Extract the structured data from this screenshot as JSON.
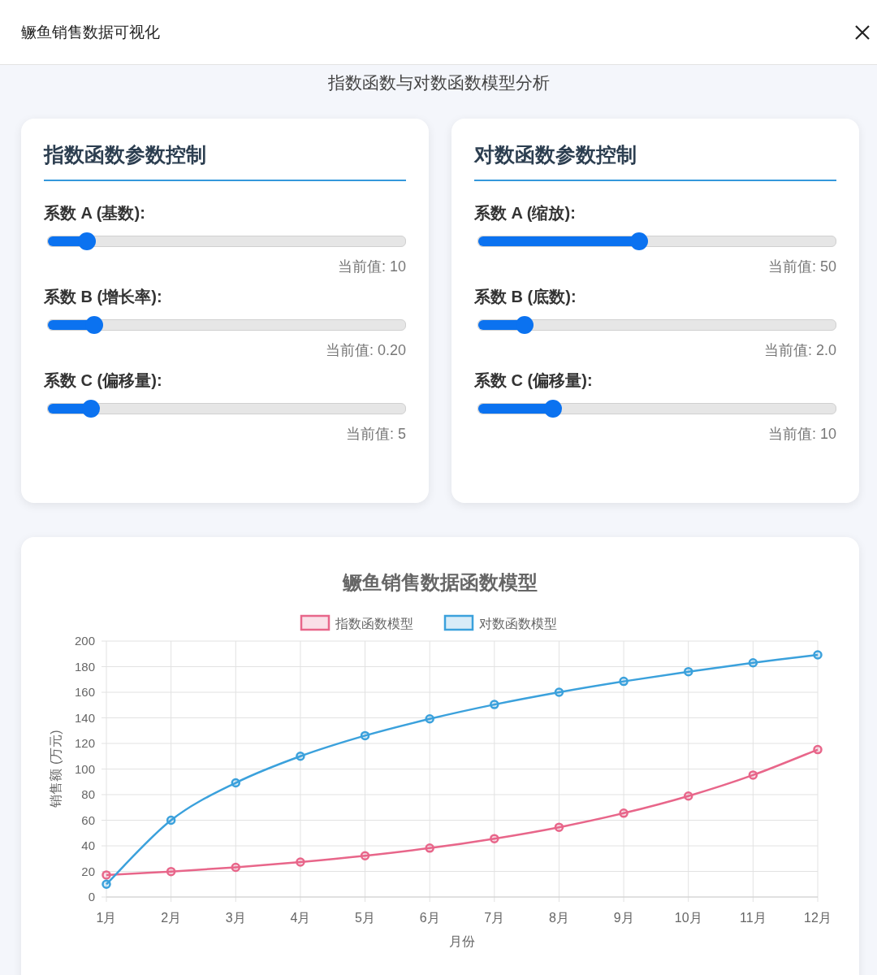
{
  "window": {
    "title": "鳜鱼销售数据可视化"
  },
  "subtitle": "指数函数与对数函数模型分析",
  "panels": [
    {
      "title": "指数函数参数控制",
      "params": [
        {
          "label": "系数 A (基数):",
          "level": 0.11,
          "reading": "当前值: 10"
        },
        {
          "label": "系数 B (增长率):",
          "level": 0.13,
          "reading": "当前值: 0.20"
        },
        {
          "label": "系数 C (偏移量):",
          "level": 0.12,
          "reading": "当前值: 5"
        }
      ]
    },
    {
      "title": "对数函数参数控制",
      "params": [
        {
          "label": "系数 A (缩放):",
          "level": 0.45,
          "reading": "当前值: 50"
        },
        {
          "label": "系数 B (底数):",
          "level": 0.13,
          "reading": "当前值: 2.0"
        },
        {
          "label": "系数 C (偏移量):",
          "level": 0.21,
          "reading": "当前值: 10"
        }
      ]
    }
  ],
  "chart": {
    "chart_data": {
      "type": "line",
      "title": "鳜鱼销售数据函数模型",
      "xlabel": "月份",
      "ylabel": "销售额 (万元)",
      "categories": [
        "1月",
        "2月",
        "3月",
        "4月",
        "5月",
        "6月",
        "7月",
        "8月",
        "9月",
        "10月",
        "11月",
        "12月"
      ],
      "series": [
        {
          "name": "指数函数模型",
          "color": "#e8668a",
          "marker": "circle",
          "values": [
            17.2,
            19.9,
            23.2,
            27.3,
            32.2,
            38.2,
            45.6,
            54.5,
            65.5,
            78.9,
            95.3,
            115.2
          ]
        },
        {
          "name": "对数函数模型",
          "color": "#3ba1dc",
          "marker": "circle",
          "values": [
            10,
            60,
            89.2,
            110,
            126.1,
            139.2,
            150.4,
            160,
            168.5,
            176.1,
            183,
            189.2
          ]
        }
      ],
      "ylim": [
        0,
        200
      ],
      "grid": true,
      "legend": true,
      "yticks": [
        0,
        20,
        40,
        60,
        80,
        100,
        120,
        140,
        160,
        180,
        200
      ]
    }
  }
}
